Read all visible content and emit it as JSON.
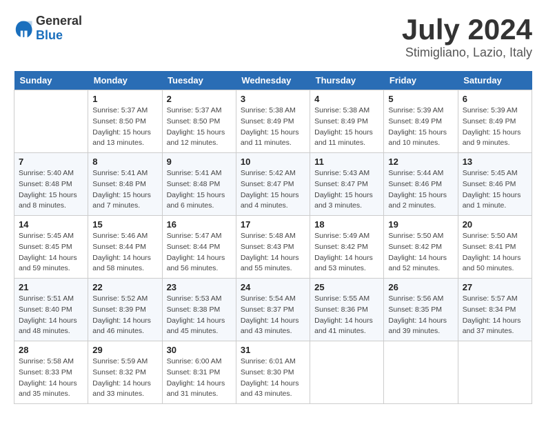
{
  "header": {
    "logo_general": "General",
    "logo_blue": "Blue",
    "title": "July 2024",
    "subtitle": "Stimigliano, Lazio, Italy"
  },
  "weekdays": [
    "Sunday",
    "Monday",
    "Tuesday",
    "Wednesday",
    "Thursday",
    "Friday",
    "Saturday"
  ],
  "weeks": [
    [
      {
        "day": "",
        "sunrise": "",
        "sunset": "",
        "daylight": ""
      },
      {
        "day": "1",
        "sunrise": "Sunrise: 5:37 AM",
        "sunset": "Sunset: 8:50 PM",
        "daylight": "Daylight: 15 hours and 13 minutes."
      },
      {
        "day": "2",
        "sunrise": "Sunrise: 5:37 AM",
        "sunset": "Sunset: 8:50 PM",
        "daylight": "Daylight: 15 hours and 12 minutes."
      },
      {
        "day": "3",
        "sunrise": "Sunrise: 5:38 AM",
        "sunset": "Sunset: 8:49 PM",
        "daylight": "Daylight: 15 hours and 11 minutes."
      },
      {
        "day": "4",
        "sunrise": "Sunrise: 5:38 AM",
        "sunset": "Sunset: 8:49 PM",
        "daylight": "Daylight: 15 hours and 11 minutes."
      },
      {
        "day": "5",
        "sunrise": "Sunrise: 5:39 AM",
        "sunset": "Sunset: 8:49 PM",
        "daylight": "Daylight: 15 hours and 10 minutes."
      },
      {
        "day": "6",
        "sunrise": "Sunrise: 5:39 AM",
        "sunset": "Sunset: 8:49 PM",
        "daylight": "Daylight: 15 hours and 9 minutes."
      }
    ],
    [
      {
        "day": "7",
        "sunrise": "Sunrise: 5:40 AM",
        "sunset": "Sunset: 8:48 PM",
        "daylight": "Daylight: 15 hours and 8 minutes."
      },
      {
        "day": "8",
        "sunrise": "Sunrise: 5:41 AM",
        "sunset": "Sunset: 8:48 PM",
        "daylight": "Daylight: 15 hours and 7 minutes."
      },
      {
        "day": "9",
        "sunrise": "Sunrise: 5:41 AM",
        "sunset": "Sunset: 8:48 PM",
        "daylight": "Daylight: 15 hours and 6 minutes."
      },
      {
        "day": "10",
        "sunrise": "Sunrise: 5:42 AM",
        "sunset": "Sunset: 8:47 PM",
        "daylight": "Daylight: 15 hours and 4 minutes."
      },
      {
        "day": "11",
        "sunrise": "Sunrise: 5:43 AM",
        "sunset": "Sunset: 8:47 PM",
        "daylight": "Daylight: 15 hours and 3 minutes."
      },
      {
        "day": "12",
        "sunrise": "Sunrise: 5:44 AM",
        "sunset": "Sunset: 8:46 PM",
        "daylight": "Daylight: 15 hours and 2 minutes."
      },
      {
        "day": "13",
        "sunrise": "Sunrise: 5:45 AM",
        "sunset": "Sunset: 8:46 PM",
        "daylight": "Daylight: 15 hours and 1 minute."
      }
    ],
    [
      {
        "day": "14",
        "sunrise": "Sunrise: 5:45 AM",
        "sunset": "Sunset: 8:45 PM",
        "daylight": "Daylight: 14 hours and 59 minutes."
      },
      {
        "day": "15",
        "sunrise": "Sunrise: 5:46 AM",
        "sunset": "Sunset: 8:44 PM",
        "daylight": "Daylight: 14 hours and 58 minutes."
      },
      {
        "day": "16",
        "sunrise": "Sunrise: 5:47 AM",
        "sunset": "Sunset: 8:44 PM",
        "daylight": "Daylight: 14 hours and 56 minutes."
      },
      {
        "day": "17",
        "sunrise": "Sunrise: 5:48 AM",
        "sunset": "Sunset: 8:43 PM",
        "daylight": "Daylight: 14 hours and 55 minutes."
      },
      {
        "day": "18",
        "sunrise": "Sunrise: 5:49 AM",
        "sunset": "Sunset: 8:42 PM",
        "daylight": "Daylight: 14 hours and 53 minutes."
      },
      {
        "day": "19",
        "sunrise": "Sunrise: 5:50 AM",
        "sunset": "Sunset: 8:42 PM",
        "daylight": "Daylight: 14 hours and 52 minutes."
      },
      {
        "day": "20",
        "sunrise": "Sunrise: 5:50 AM",
        "sunset": "Sunset: 8:41 PM",
        "daylight": "Daylight: 14 hours and 50 minutes."
      }
    ],
    [
      {
        "day": "21",
        "sunrise": "Sunrise: 5:51 AM",
        "sunset": "Sunset: 8:40 PM",
        "daylight": "Daylight: 14 hours and 48 minutes."
      },
      {
        "day": "22",
        "sunrise": "Sunrise: 5:52 AM",
        "sunset": "Sunset: 8:39 PM",
        "daylight": "Daylight: 14 hours and 46 minutes."
      },
      {
        "day": "23",
        "sunrise": "Sunrise: 5:53 AM",
        "sunset": "Sunset: 8:38 PM",
        "daylight": "Daylight: 14 hours and 45 minutes."
      },
      {
        "day": "24",
        "sunrise": "Sunrise: 5:54 AM",
        "sunset": "Sunset: 8:37 PM",
        "daylight": "Daylight: 14 hours and 43 minutes."
      },
      {
        "day": "25",
        "sunrise": "Sunrise: 5:55 AM",
        "sunset": "Sunset: 8:36 PM",
        "daylight": "Daylight: 14 hours and 41 minutes."
      },
      {
        "day": "26",
        "sunrise": "Sunrise: 5:56 AM",
        "sunset": "Sunset: 8:35 PM",
        "daylight": "Daylight: 14 hours and 39 minutes."
      },
      {
        "day": "27",
        "sunrise": "Sunrise: 5:57 AM",
        "sunset": "Sunset: 8:34 PM",
        "daylight": "Daylight: 14 hours and 37 minutes."
      }
    ],
    [
      {
        "day": "28",
        "sunrise": "Sunrise: 5:58 AM",
        "sunset": "Sunset: 8:33 PM",
        "daylight": "Daylight: 14 hours and 35 minutes."
      },
      {
        "day": "29",
        "sunrise": "Sunrise: 5:59 AM",
        "sunset": "Sunset: 8:32 PM",
        "daylight": "Daylight: 14 hours and 33 minutes."
      },
      {
        "day": "30",
        "sunrise": "Sunrise: 6:00 AM",
        "sunset": "Sunset: 8:31 PM",
        "daylight": "Daylight: 14 hours and 31 minutes."
      },
      {
        "day": "31",
        "sunrise": "Sunrise: 6:01 AM",
        "sunset": "Sunset: 8:30 PM",
        "daylight": "Daylight: 14 hours and 43 minutes."
      },
      {
        "day": "",
        "sunrise": "",
        "sunset": "",
        "daylight": ""
      },
      {
        "day": "",
        "sunrise": "",
        "sunset": "",
        "daylight": ""
      },
      {
        "day": "",
        "sunrise": "",
        "sunset": "",
        "daylight": ""
      }
    ]
  ]
}
